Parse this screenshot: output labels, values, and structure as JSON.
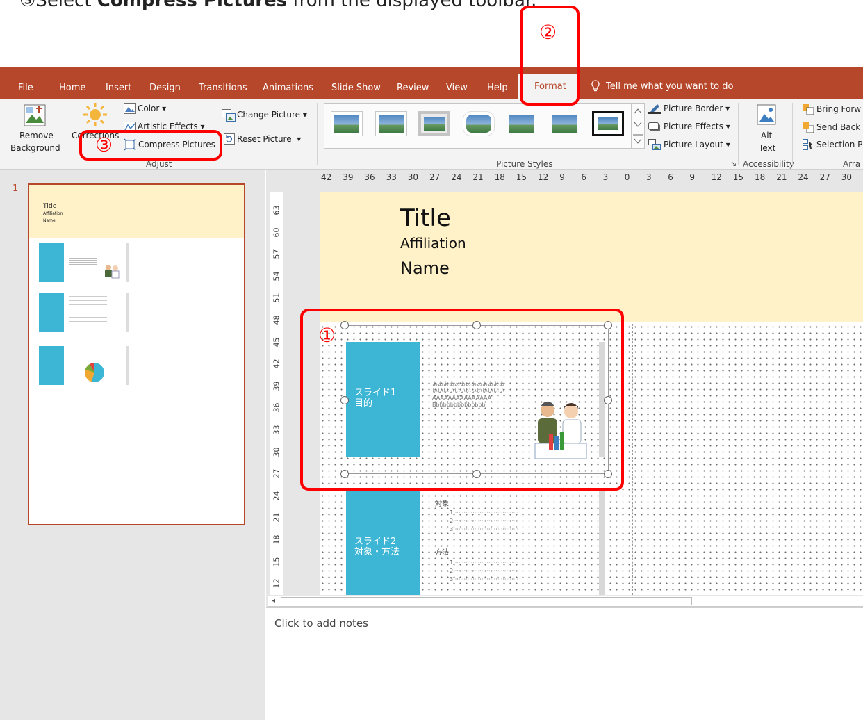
{
  "instruction": {
    "prefix": "③Select ",
    "bold": "Compress Pictures",
    "suffix": " from the displayed toolbar."
  },
  "tabs": {
    "file": "File",
    "home": "Home",
    "insert": "Insert",
    "design": "Design",
    "transitions": "Transitions",
    "animations": "Animations",
    "slideshow": "Slide Show",
    "review": "Review",
    "view": "View",
    "help": "Help",
    "format": "Format",
    "tell": "Tell me what you want to do"
  },
  "ribbon": {
    "remove_bg_1": "Remove",
    "remove_bg_2": "Background",
    "corrections": "Corrections",
    "color": "Color",
    "artistic": "Artistic Effects",
    "compress": "Compress Pictures",
    "change_picture": "Change Picture",
    "reset_picture": "Reset Picture",
    "adjust": "Adjust",
    "picture_styles": "Picture Styles",
    "picture_border": "Picture Border",
    "picture_effects": "Picture Effects",
    "picture_layout": "Picture Layout",
    "alt_1": "Alt",
    "alt_2": "Text",
    "accessibility": "Accessibility",
    "bring_forward": "Bring Forw",
    "send_backward": "Send Back",
    "selection_pane": "Selection P",
    "arrange": "Arra"
  },
  "thumbnails": {
    "number": "1",
    "title": "Title",
    "affiliation": "Affiliation",
    "name": "Name"
  },
  "ruler": {
    "horizontal": [
      "42",
      "39",
      "36",
      "33",
      "30",
      "27",
      "24",
      "21",
      "18",
      "15",
      "12",
      "9",
      "6",
      "3",
      "0",
      "3",
      "6",
      "9",
      "12",
      "15",
      "18",
      "21",
      "24",
      "27",
      "30"
    ],
    "vertical": [
      "63",
      "60",
      "57",
      "54",
      "51",
      "48",
      "45",
      "42",
      "39",
      "36",
      "33",
      "30",
      "27",
      "24",
      "21",
      "18",
      "15",
      "12"
    ]
  },
  "slide": {
    "title": "Title",
    "affiliation": "Affiliation",
    "name": "Name",
    "box1_line1": "スライド1",
    "box1_line2": "目的",
    "box2_line1": "スライド2",
    "box2_line2": "対象・方法",
    "text_rows": [
      "あああああああああああああ",
      "いいいいいいいいいいいいい",
      "AAAAAAAAAAAAAAA",
      "Bbbbbbbbbbbbbbb"
    ],
    "section_a": "対象",
    "section_b": "方法",
    "list_a": [
      "1",
      "2",
      "3"
    ],
    "list_b": [
      "1",
      "2",
      "3"
    ]
  },
  "notes": {
    "placeholder": "Click to add notes"
  },
  "annotations": {
    "one": "①",
    "two": "②",
    "three": "③"
  },
  "colors": {
    "accent": "#b7472a",
    "callout": "#ff0000",
    "slide_band": "#fff1c8",
    "teal_box": "#3db5d4"
  }
}
